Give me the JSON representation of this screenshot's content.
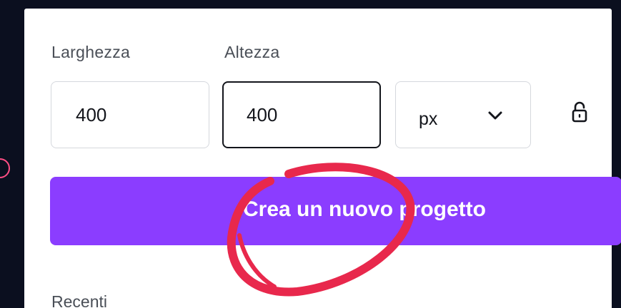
{
  "dimensions": {
    "width_label": "Larghezza",
    "height_label": "Altezza",
    "width_value": "400",
    "height_value": "400",
    "unit_value": "px"
  },
  "icons": {
    "unit_chevron": "chevron-down-icon",
    "lock": "lock-open-icon"
  },
  "actions": {
    "create_label": "Crea un nuovo progetto"
  },
  "sections": {
    "recent_label": "Recenti"
  },
  "colors": {
    "background": "#0b0f1f",
    "panel": "#ffffff",
    "primary_button": "#8b3dff",
    "focus_border": "#13151b",
    "annotation_stroke": "#e8284c"
  }
}
